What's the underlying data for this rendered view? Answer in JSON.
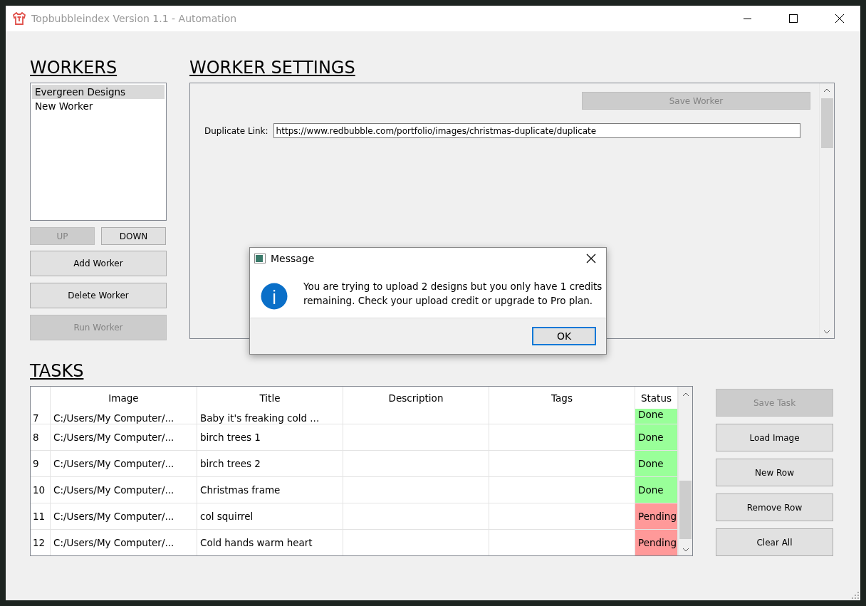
{
  "window": {
    "title": "Topbubbleindex Version 1.1 - Automation"
  },
  "workers": {
    "heading": "WORKERS",
    "items": [
      {
        "label": "Evergreen Designs",
        "selected": true
      },
      {
        "label": "New Worker",
        "selected": false
      }
    ],
    "move_buttons": [
      {
        "label": "UP",
        "disabled": true
      },
      {
        "label": "DOWN",
        "disabled": false
      }
    ],
    "buttons": [
      {
        "label": "Add Worker",
        "disabled": false
      },
      {
        "label": "Delete Worker",
        "disabled": false
      },
      {
        "label": "Run Worker",
        "disabled": true
      }
    ]
  },
  "worker_settings": {
    "heading": "WORKER SETTINGS",
    "save_button": {
      "label": "Save Worker",
      "disabled": true
    },
    "duplicate_link": {
      "label": "Duplicate Link:",
      "value": "https://www.redbubble.com/portfolio/images/christmas-duplicate/duplicate"
    }
  },
  "tasks": {
    "heading": "TASKS",
    "columns": [
      "Image",
      "Title",
      "Description",
      "Tags",
      "Status"
    ],
    "rows": [
      {
        "number": "7",
        "image": "C:/Users/My Computer/...",
        "title": "Baby it's freaking cold ...",
        "status": "Done",
        "color": "#99ff99"
      },
      {
        "number": "8",
        "image": "C:/Users/My Computer/...",
        "title": "birch trees 1",
        "status": "Done",
        "color": "#99ff99"
      },
      {
        "number": "9",
        "image": "C:/Users/My Computer/...",
        "title": "birch trees 2",
        "status": "Done",
        "color": "#99ff99"
      },
      {
        "number": "10",
        "image": "C:/Users/My Computer/...",
        "title": "Christmas frame",
        "status": "Done",
        "color": "#99ff99"
      },
      {
        "number": "11",
        "image": "C:/Users/My Computer/...",
        "title": "col squirrel",
        "status": "Pending",
        "color": "#ff9999"
      },
      {
        "number": "12",
        "image": "C:/Users/My Computer/...",
        "title": "Cold hands warm heart",
        "status": "Pending",
        "color": "#ff9999"
      }
    ],
    "buttons": [
      {
        "label": "Save Task",
        "disabled": true
      },
      {
        "label": "Load Image",
        "disabled": false
      },
      {
        "label": "New Row",
        "disabled": false
      },
      {
        "label": "Remove Row",
        "disabled": false
      },
      {
        "label": "Clear All",
        "disabled": false
      }
    ]
  },
  "dialog": {
    "title": "Message",
    "message": "You are trying to upload 2 designs but you only have 1 credits remaining. Check your upload credit or upgrade to Pro plan.",
    "button": "OK"
  }
}
